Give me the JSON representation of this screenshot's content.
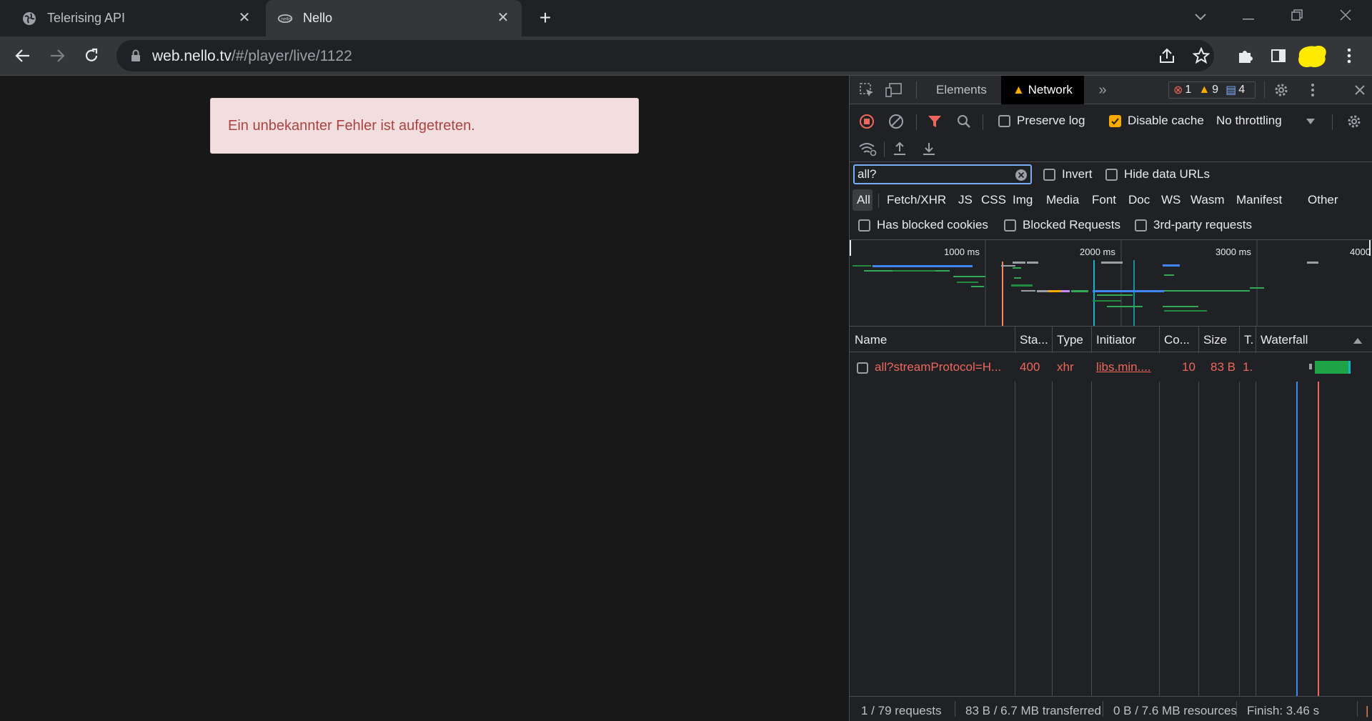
{
  "tabs": [
    {
      "title": "Telerising API",
      "icon": "globe-icon"
    },
    {
      "title": "Nello",
      "icon": "nello-logo-icon"
    }
  ],
  "toolbar": {
    "url_host": "web.nello.tv",
    "url_path": "/#/player/live/1122"
  },
  "page": {
    "error_message": "Ein unbekannter Fehler ist aufgetreten."
  },
  "devtools": {
    "tabs": {
      "elements": "Elements",
      "network": "Network"
    },
    "badges": {
      "errors": "1",
      "warnings": "9",
      "messages": "4"
    },
    "controls": {
      "preserve_log": "Preserve log",
      "disable_cache": "Disable cache",
      "throttling": "No throttling",
      "filter_value": "all?",
      "invert": "Invert",
      "hide_data_urls": "Hide data URLs",
      "has_blocked_cookies": "Has blocked cookies",
      "blocked_requests": "Blocked Requests",
      "third_party": "3rd-party requests"
    },
    "type_filters": [
      "All",
      "Fetch/XHR",
      "JS",
      "CSS",
      "Img",
      "Media",
      "Font",
      "Doc",
      "WS",
      "Wasm",
      "Manifest",
      "Other"
    ],
    "overview_ticks": [
      "1000 ms",
      "2000 ms",
      "3000 ms",
      "4000"
    ],
    "columns": {
      "name": "Name",
      "status": "Sta...",
      "type": "Type",
      "initiator": "Initiator",
      "cookies": "Co...",
      "size": "Size",
      "time": "T.",
      "waterfall": "Waterfall"
    },
    "rows": [
      {
        "name": "all?streamProtocol=H...",
        "status": "400",
        "type": "xhr",
        "initiator": "libs.min....",
        "cookies": "10",
        "size": "83 B",
        "time": "1."
      }
    ],
    "status": {
      "requests": "1 / 79 requests",
      "transferred": "83 B / 6.7 MB transferred",
      "resources": "0 B / 7.6 MB resources",
      "finish": "Finish: 3.46 s"
    }
  }
}
